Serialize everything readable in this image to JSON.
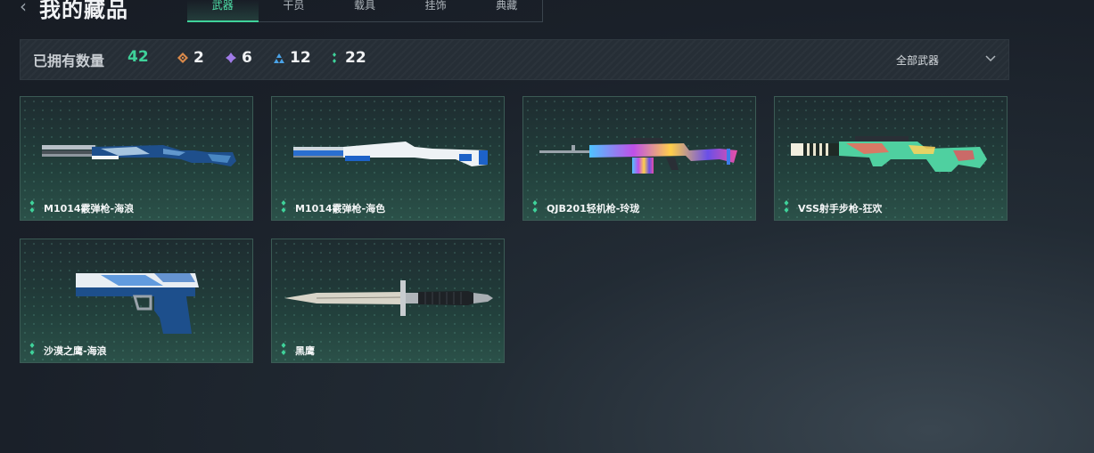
{
  "header": {
    "title": "我的藏品",
    "tabs": [
      {
        "label": "武器",
        "active": true
      },
      {
        "label": "干员",
        "active": false
      },
      {
        "label": "载具",
        "active": false
      },
      {
        "label": "挂饰",
        "active": false
      },
      {
        "label": "典藏",
        "active": false
      }
    ]
  },
  "summary": {
    "owned_label": "已拥有数量",
    "owned_count": "42",
    "rarities": [
      {
        "icon": "orange-diamond-icon",
        "color": "#d9894a",
        "count": "2"
      },
      {
        "icon": "purple-diamond-icon",
        "color": "#a07be8",
        "count": "6"
      },
      {
        "icon": "blue-triangle-icon",
        "color": "#4aa3e8",
        "count": "12"
      },
      {
        "icon": "green-dots-icon",
        "color": "#3fd29a",
        "count": "22"
      }
    ],
    "filter_label": "全部武器"
  },
  "items": [
    {
      "name": "M1014霰弹枪-海浪",
      "rarity_color": "#3fd29a",
      "skin": "blue-marble"
    },
    {
      "name": "M1014霰弹枪-海色",
      "rarity_color": "#3fd29a",
      "skin": "white-blue"
    },
    {
      "name": "QJB201轻机枪-玲珑",
      "rarity_color": "#3fd29a",
      "skin": "holo"
    },
    {
      "name": "VSS射手步枪-狂欢",
      "rarity_color": "#3fd29a",
      "skin": "floral"
    },
    {
      "name": "沙漠之鹰-海浪",
      "rarity_color": "#3fd29a",
      "skin": "blue-marble"
    },
    {
      "name": "黑鹰",
      "rarity_color": "#3fd29a",
      "skin": "knife"
    }
  ]
}
